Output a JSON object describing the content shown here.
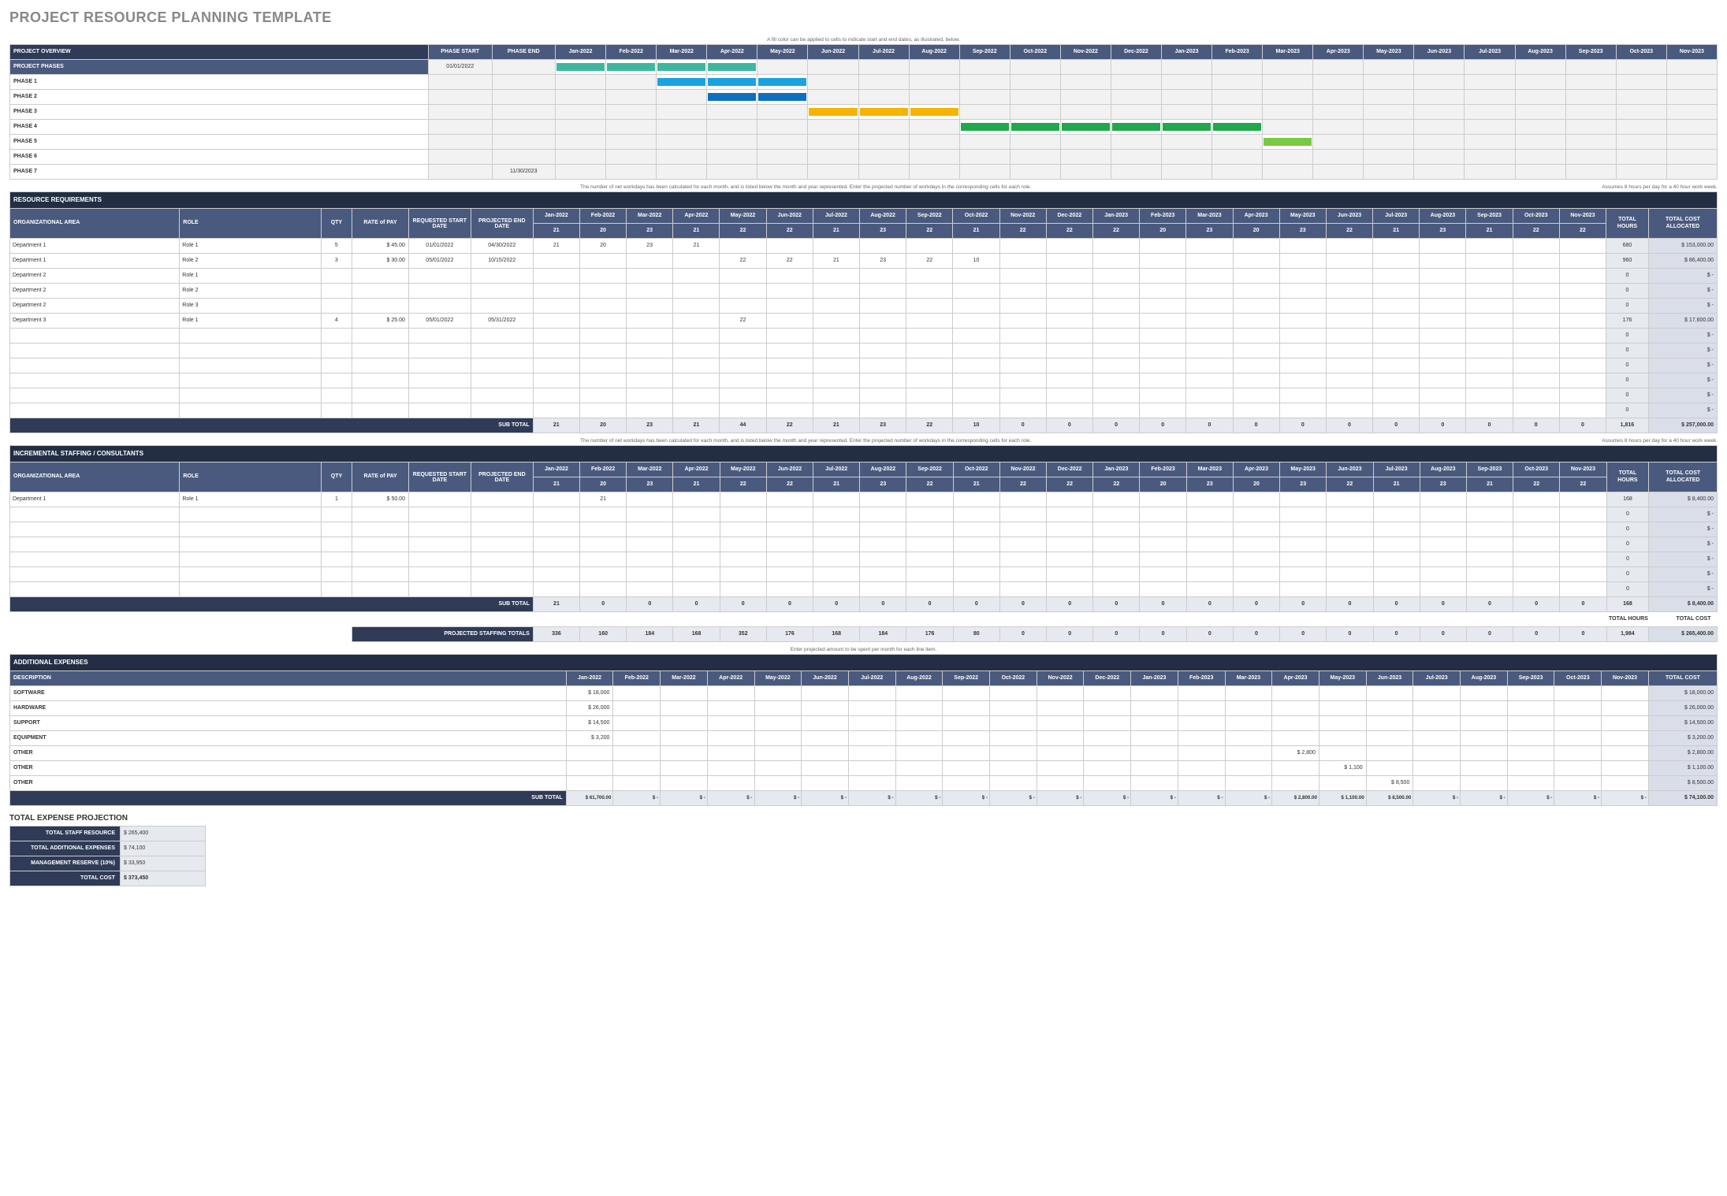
{
  "title": "PROJECT RESOURCE PLANNING TEMPLATE",
  "months": [
    "Jan-2022",
    "Feb-2022",
    "Mar-2022",
    "Apr-2022",
    "May-2022",
    "Jun-2022",
    "Jul-2022",
    "Aug-2022",
    "Sep-2022",
    "Oct-2022",
    "Nov-2022",
    "Dec-2022",
    "Jan-2023",
    "Feb-2023",
    "Mar-2023",
    "Apr-2023",
    "May-2023",
    "Jun-2023",
    "Jul-2023",
    "Aug-2023",
    "Sep-2023",
    "Oct-2023",
    "Nov-2023"
  ],
  "workdays": [
    "21",
    "20",
    "23",
    "21",
    "22",
    "22",
    "21",
    "23",
    "22",
    "21",
    "22",
    "22",
    "22",
    "20",
    "23",
    "20",
    "23",
    "22",
    "21",
    "23",
    "21",
    "22",
    "22"
  ],
  "workdays2": [
    "21",
    "20",
    "23",
    "21",
    "22",
    "22",
    "21",
    "23",
    "22",
    "10",
    "-",
    "-",
    "-",
    "-",
    "-",
    "-",
    "-",
    "-",
    "-",
    "-",
    "-",
    "-",
    "-"
  ],
  "overview": {
    "title": "PROJECT OVERVIEW",
    "col_start": "PHASE START",
    "col_end": "PHASE END",
    "note": "A fill color can be applied to cells to indicate start and end dates, as illustrated, below.",
    "rows": [
      {
        "label": "PROJECT PHASES",
        "start": "01/01/2022",
        "end": "",
        "bar_from": 0,
        "bar_to": 4,
        "color": "#3fb6a0",
        "italic": false,
        "hl": true
      },
      {
        "label": "PHASE 1",
        "start": "",
        "end": "",
        "bar_from": 2,
        "bar_to": 5,
        "color": "#1aa3e0"
      },
      {
        "label": "PHASE 2",
        "start": "",
        "end": "",
        "bar_from": 3,
        "bar_to": 5,
        "color": "#0d6fbf"
      },
      {
        "label": "PHASE 3",
        "start": "",
        "end": "",
        "bar_from": 5,
        "bar_to": 8,
        "color": "#f5b400"
      },
      {
        "label": "PHASE 4",
        "start": "",
        "end": "",
        "bar_from": 8,
        "bar_to": 14,
        "color": "#1fa84c"
      },
      {
        "label": "PHASE 5",
        "start": "",
        "end": "",
        "bar_from": 14,
        "bar_to": 15,
        "color": "#7ac943"
      },
      {
        "label": "PHASE 6",
        "start": "",
        "end": "",
        "bar_from": -1,
        "bar_to": -1,
        "color": ""
      },
      {
        "label": "PHASE 7",
        "start": "",
        "end": "11/30/2023",
        "bar_from": -1,
        "bar_to": -1,
        "color": ""
      }
    ]
  },
  "resource_req": {
    "title": "RESOURCE REQUIREMENTS",
    "note_left": "The number of net workdays has been calculated for each month, and is listed below the month and year represented. Enter the projected number of workdays in the corresponding cells for each role.",
    "note_right": "Assumes 8 hours per day for a 40 hour work week.",
    "headers": {
      "area": "ORGANIZATIONAL AREA",
      "role": "ROLE",
      "qty": "QTY",
      "rate": "RATE of PAY",
      "rstart": "REQUESTED START DATE",
      "pend": "PROJECTED END DATE",
      "th": "TOTAL HOURS",
      "tc": "TOTAL COST ALLOCATED"
    },
    "rows": [
      {
        "area": "Department 1",
        "role": "Role 1",
        "qty": "5",
        "rate": "$   45.00",
        "rstart": "01/01/2022",
        "pend": "04/30/2022",
        "m": [
          "21",
          "20",
          "23",
          "21",
          "",
          "",
          "",
          "",
          "",
          "",
          "",
          "",
          "",
          "",
          "",
          "",
          "",
          "",
          "",
          "",
          "",
          "",
          ""
        ],
        "th": "680",
        "tc": "$   153,000.00"
      },
      {
        "area": "Department 1",
        "role": "Role 2",
        "qty": "3",
        "rate": "$   30.00",
        "rstart": "05/01/2022",
        "pend": "10/15/2022",
        "m": [
          "",
          "",
          "",
          "",
          "22",
          "22",
          "21",
          "23",
          "22",
          "10",
          "",
          "",
          "",
          "",
          "",
          "",
          "",
          "",
          "",
          "",
          "",
          "",
          ""
        ],
        "th": "960",
        "tc": "$    86,400.00"
      },
      {
        "area": "Department 2",
        "role": "Role 1",
        "qty": "",
        "rate": "",
        "rstart": "",
        "pend": "",
        "m": [
          "",
          "",
          "",
          "",
          "",
          "",
          "",
          "",
          "",
          "",
          "",
          "",
          "",
          "",
          "",
          "",
          "",
          "",
          "",
          "",
          "",
          "",
          ""
        ],
        "th": "0",
        "tc": "$          -"
      },
      {
        "area": "Department 2",
        "role": "Role 2",
        "qty": "",
        "rate": "",
        "rstart": "",
        "pend": "",
        "m": [
          "",
          "",
          "",
          "",
          "",
          "",
          "",
          "",
          "",
          "",
          "",
          "",
          "",
          "",
          "",
          "",
          "",
          "",
          "",
          "",
          "",
          "",
          ""
        ],
        "th": "0",
        "tc": "$          -"
      },
      {
        "area": "Department 2",
        "role": "Role 3",
        "qty": "",
        "rate": "",
        "rstart": "",
        "pend": "",
        "m": [
          "",
          "",
          "",
          "",
          "",
          "",
          "",
          "",
          "",
          "",
          "",
          "",
          "",
          "",
          "",
          "",
          "",
          "",
          "",
          "",
          "",
          "",
          ""
        ],
        "th": "0",
        "tc": "$          -"
      },
      {
        "area": "Department 3",
        "role": "Role 1",
        "qty": "4",
        "rate": "$   25.00",
        "rstart": "05/01/2022",
        "pend": "05/31/2022",
        "m": [
          "",
          "",
          "",
          "",
          "22",
          "",
          "",
          "",
          "",
          "",
          "",
          "",
          "",
          "",
          "",
          "",
          "",
          "",
          "",
          "",
          "",
          "",
          ""
        ],
        "th": "176",
        "tc": "$    17,600.00"
      },
      {
        "area": "",
        "role": "",
        "qty": "",
        "rate": "",
        "rstart": "",
        "pend": "",
        "m": [
          "",
          "",
          "",
          "",
          "",
          "",
          "",
          "",
          "",
          "",
          "",
          "",
          "",
          "",
          "",
          "",
          "",
          "",
          "",
          "",
          "",
          "",
          ""
        ],
        "th": "0",
        "tc": "$          -"
      },
      {
        "area": "",
        "role": "",
        "qty": "",
        "rate": "",
        "rstart": "",
        "pend": "",
        "m": [
          "",
          "",
          "",
          "",
          "",
          "",
          "",
          "",
          "",
          "",
          "",
          "",
          "",
          "",
          "",
          "",
          "",
          "",
          "",
          "",
          "",
          "",
          ""
        ],
        "th": "0",
        "tc": "$          -"
      },
      {
        "area": "",
        "role": "",
        "qty": "",
        "rate": "",
        "rstart": "",
        "pend": "",
        "m": [
          "",
          "",
          "",
          "",
          "",
          "",
          "",
          "",
          "",
          "",
          "",
          "",
          "",
          "",
          "",
          "",
          "",
          "",
          "",
          "",
          "",
          "",
          ""
        ],
        "th": "0",
        "tc": "$          -"
      },
      {
        "area": "",
        "role": "",
        "qty": "",
        "rate": "",
        "rstart": "",
        "pend": "",
        "m": [
          "",
          "",
          "",
          "",
          "",
          "",
          "",
          "",
          "",
          "",
          "",
          "",
          "",
          "",
          "",
          "",
          "",
          "",
          "",
          "",
          "",
          "",
          ""
        ],
        "th": "0",
        "tc": "$          -"
      },
      {
        "area": "",
        "role": "",
        "qty": "",
        "rate": "",
        "rstart": "",
        "pend": "",
        "m": [
          "",
          "",
          "",
          "",
          "",
          "",
          "",
          "",
          "",
          "",
          "",
          "",
          "",
          "",
          "",
          "",
          "",
          "",
          "",
          "",
          "",
          "",
          ""
        ],
        "th": "0",
        "tc": "$          -"
      },
      {
        "area": "",
        "role": "",
        "qty": "",
        "rate": "",
        "rstart": "",
        "pend": "",
        "m": [
          "",
          "",
          "",
          "",
          "",
          "",
          "",
          "",
          "",
          "",
          "",
          "",
          "",
          "",
          "",
          "",
          "",
          "",
          "",
          "",
          "",
          "",
          ""
        ],
        "th": "0",
        "tc": "$          -"
      }
    ],
    "subtotal_label": "SUB TOTAL",
    "subtotal_m": [
      "21",
      "20",
      "23",
      "21",
      "44",
      "22",
      "21",
      "23",
      "22",
      "10",
      "0",
      "0",
      "0",
      "0",
      "0",
      "0",
      "0",
      "0",
      "0",
      "0",
      "0",
      "0",
      "0"
    ],
    "subtotal_th": "1,816",
    "subtotal_tc": "$   257,000.00"
  },
  "incremental": {
    "title": "INCREMENTAL STAFFING / CONSULTANTS",
    "note_left": "The number of net workdays has been calculated for each month, and is listed below the month and year represented. Enter the projected number of workdays in the corresponding cells for each role.",
    "note_right": "Assumes 8 hours per day for a 40 hour work week.",
    "rows": [
      {
        "area": "Department 1",
        "role": "Role 1",
        "qty": "1",
        "rate": "$   50.00",
        "rstart": "",
        "pend": "",
        "m": [
          "",
          "21",
          "",
          "",
          "",
          "",
          "",
          "",
          "",
          "",
          "",
          "",
          "",
          "",
          "",
          "",
          "",
          "",
          "",
          "",
          "",
          "",
          ""
        ],
        "th": "168",
        "tc": "$     8,400.00"
      },
      {
        "area": "",
        "role": "",
        "qty": "",
        "rate": "",
        "rstart": "",
        "pend": "",
        "m": [
          "",
          "",
          "",
          "",
          "",
          "",
          "",
          "",
          "",
          "",
          "",
          "",
          "",
          "",
          "",
          "",
          "",
          "",
          "",
          "",
          "",
          "",
          ""
        ],
        "th": "0",
        "tc": "$          -"
      },
      {
        "area": "",
        "role": "",
        "qty": "",
        "rate": "",
        "rstart": "",
        "pend": "",
        "m": [
          "",
          "",
          "",
          "",
          "",
          "",
          "",
          "",
          "",
          "",
          "",
          "",
          "",
          "",
          "",
          "",
          "",
          "",
          "",
          "",
          "",
          "",
          ""
        ],
        "th": "0",
        "tc": "$          -"
      },
      {
        "area": "",
        "role": "",
        "qty": "",
        "rate": "",
        "rstart": "",
        "pend": "",
        "m": [
          "",
          "",
          "",
          "",
          "",
          "",
          "",
          "",
          "",
          "",
          "",
          "",
          "",
          "",
          "",
          "",
          "",
          "",
          "",
          "",
          "",
          "",
          ""
        ],
        "th": "0",
        "tc": "$          -"
      },
      {
        "area": "",
        "role": "",
        "qty": "",
        "rate": "",
        "rstart": "",
        "pend": "",
        "m": [
          "",
          "",
          "",
          "",
          "",
          "",
          "",
          "",
          "",
          "",
          "",
          "",
          "",
          "",
          "",
          "",
          "",
          "",
          "",
          "",
          "",
          "",
          ""
        ],
        "th": "0",
        "tc": "$          -"
      },
      {
        "area": "",
        "role": "",
        "qty": "",
        "rate": "",
        "rstart": "",
        "pend": "",
        "m": [
          "",
          "",
          "",
          "",
          "",
          "",
          "",
          "",
          "",
          "",
          "",
          "",
          "",
          "",
          "",
          "",
          "",
          "",
          "",
          "",
          "",
          "",
          ""
        ],
        "th": "0",
        "tc": "$          -"
      },
      {
        "area": "",
        "role": "",
        "qty": "",
        "rate": "",
        "rstart": "",
        "pend": "",
        "m": [
          "",
          "",
          "",
          "",
          "",
          "",
          "",
          "",
          "",
          "",
          "",
          "",
          "",
          "",
          "",
          "",
          "",
          "",
          "",
          "",
          "",
          "",
          ""
        ],
        "th": "0",
        "tc": "$          -"
      }
    ],
    "subtotal_label": "SUB TOTAL",
    "subtotal_m": [
      "21",
      "0",
      "0",
      "0",
      "0",
      "0",
      "0",
      "0",
      "0",
      "0",
      "0",
      "0",
      "0",
      "0",
      "0",
      "0",
      "0",
      "0",
      "0",
      "0",
      "0",
      "0",
      "0"
    ],
    "subtotal_th": "168",
    "subtotal_tc": "$     8,400.00",
    "grand_hours_label": "TOTAL HOURS",
    "grand_cost_label": "TOTAL COST",
    "grand_label": "PROJECTED STAFFING TOTALS",
    "grand_m": [
      "336",
      "160",
      "184",
      "168",
      "352",
      "176",
      "168",
      "184",
      "176",
      "80",
      "0",
      "0",
      "0",
      "0",
      "0",
      "0",
      "0",
      "0",
      "0",
      "0",
      "0",
      "0",
      "0"
    ],
    "grand_th": "1,984",
    "grand_tc": "$   265,400.00"
  },
  "additional": {
    "title": "ADDITIONAL EXPENSES",
    "note": "Enter projected amount to be spent per month for each line item.",
    "desc": "DESCRIPTION",
    "tc": "TOTAL COST",
    "rows": [
      {
        "desc": "SOFTWARE",
        "m": [
          "$  18,000",
          "",
          "",
          "",
          "",
          "",
          "",
          "",
          "",
          "",
          "",
          "",
          "",
          "",
          "",
          "",
          "",
          "",
          "",
          "",
          "",
          "",
          ""
        ],
        "tc": "$    18,000.00"
      },
      {
        "desc": "HARDWARE",
        "m": [
          "$  26,000",
          "",
          "",
          "",
          "",
          "",
          "",
          "",
          "",
          "",
          "",
          "",
          "",
          "",
          "",
          "",
          "",
          "",
          "",
          "",
          "",
          "",
          ""
        ],
        "tc": "$    26,000.00"
      },
      {
        "desc": "SUPPORT",
        "m": [
          "$  14,500",
          "",
          "",
          "",
          "",
          "",
          "",
          "",
          "",
          "",
          "",
          "",
          "",
          "",
          "",
          "",
          "",
          "",
          "",
          "",
          "",
          "",
          ""
        ],
        "tc": "$    14,500.00"
      },
      {
        "desc": "EQUIPMENT",
        "m": [
          "$    3,200",
          "",
          "",
          "",
          "",
          "",
          "",
          "",
          "",
          "",
          "",
          "",
          "",
          "",
          "",
          "",
          "",
          "",
          "",
          "",
          "",
          "",
          ""
        ],
        "tc": "$     3,200.00"
      },
      {
        "desc": "OTHER",
        "m": [
          "",
          "",
          "",
          "",
          "",
          "",
          "",
          "",
          "",
          "",
          "",
          "",
          "",
          "",
          "",
          "$   2,800",
          "",
          "",
          "",
          "",
          "",
          "",
          ""
        ],
        "tc": "$     2,800.00"
      },
      {
        "desc": "OTHER",
        "m": [
          "",
          "",
          "",
          "",
          "",
          "",
          "",
          "",
          "",
          "",
          "",
          "",
          "",
          "",
          "",
          "",
          "$   1,100",
          "",
          "",
          "",
          "",
          "",
          ""
        ],
        "tc": "$     1,100.00"
      },
      {
        "desc": "OTHER",
        "m": [
          "",
          "",
          "",
          "",
          "",
          "",
          "",
          "",
          "",
          "",
          "",
          "",
          "",
          "",
          "",
          "",
          "",
          "$   8,500",
          "",
          "",
          "",
          "",
          ""
        ],
        "tc": "$     8,500.00"
      }
    ],
    "subtotal_label": "SUB TOTAL",
    "subtotal_m": [
      "$ 61,700.00",
      "$        -",
      "$        -",
      "$        -",
      "$        -",
      "$        -",
      "$        -",
      "$        -",
      "$        -",
      "$        -",
      "$        -",
      "$        -",
      "$        -",
      "$        -",
      "$        -",
      "$  2,800.00",
      "$  1,100.00",
      "$  8,500.00",
      "$        -",
      "$        -",
      "$        -",
      "$        -",
      "$        -"
    ],
    "subtotal_tc": "$    74,100.00"
  },
  "projection": {
    "title": "TOTAL EXPENSE PROJECTION",
    "items": [
      {
        "label": "TOTAL STAFF RESOURCE",
        "val": "$                                265,400"
      },
      {
        "label": "TOTAL ADDITIONAL EXPENSES",
        "val": "$                                  74,100"
      },
      {
        "label": "MANAGEMENT RESERVE (10%)",
        "val": "$                                  33,950"
      },
      {
        "label": "TOTAL COST",
        "val": "$                                373,450"
      }
    ]
  }
}
